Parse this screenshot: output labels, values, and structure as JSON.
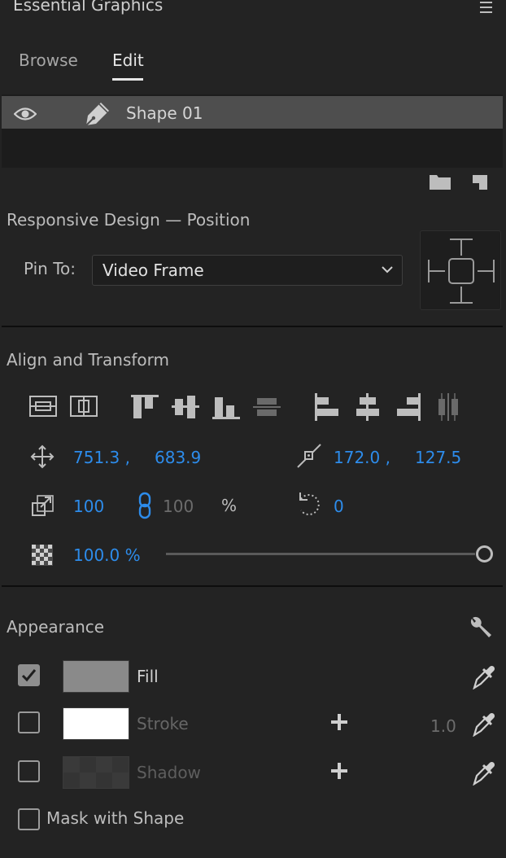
{
  "panel": {
    "title": "Essential Graphics"
  },
  "tabs": [
    {
      "label": "Browse",
      "active": false
    },
    {
      "label": "Edit",
      "active": true
    }
  ],
  "layers": [
    {
      "name": "Shape 01",
      "visible": true,
      "icon": "pen-icon"
    }
  ],
  "responsive_design": {
    "heading": "Responsive Design — Position",
    "pin_to_label": "Pin To:",
    "pin_to_value": "Video Frame"
  },
  "align_transform": {
    "heading": "Align and Transform",
    "position_x": "751.3 ,",
    "position_y": "683.9",
    "anchor_x": "172.0 ,",
    "anchor_y": "127.5",
    "scale": "100",
    "scale_linked": "100",
    "scale_unit": "%",
    "rotation": "0",
    "opacity": "100.0 %",
    "opacity_fraction": 1.0
  },
  "appearance": {
    "heading": "Appearance",
    "fill": {
      "label": "Fill",
      "enabled": true,
      "color": "#8a8a8a"
    },
    "stroke": {
      "label": "Stroke",
      "enabled": false,
      "color": "#ffffff",
      "width": "1.0"
    },
    "shadow": {
      "label": "Shadow",
      "enabled": false
    },
    "mask": {
      "label": "Mask with Shape",
      "enabled": false
    }
  },
  "colors": {
    "accent": "#2d8ceb",
    "background": "#232323",
    "text": "#bdbdbd"
  }
}
